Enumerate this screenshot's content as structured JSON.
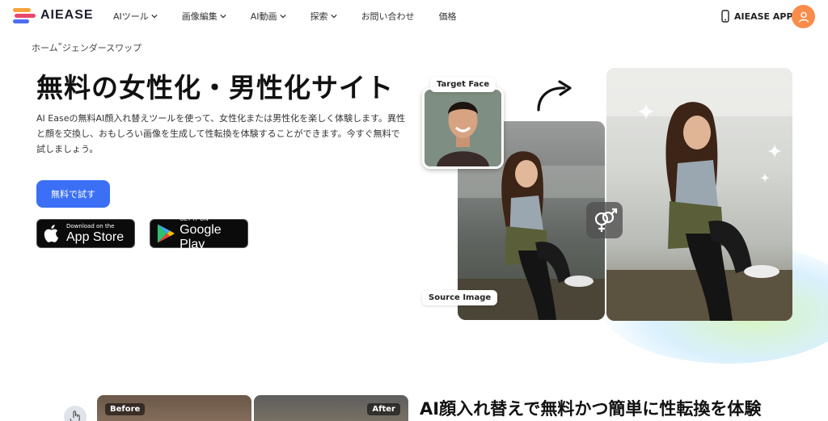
{
  "nav": {
    "logo_text": "AIEASE",
    "items": [
      {
        "label": "AIツール",
        "has_dropdown": true
      },
      {
        "label": "画像編集",
        "has_dropdown": true
      },
      {
        "label": "AI動画",
        "has_dropdown": true
      },
      {
        "label": "探索",
        "has_dropdown": true
      },
      {
        "label": "お問い合わせ",
        "has_dropdown": false
      },
      {
        "label": "価格",
        "has_dropdown": false
      }
    ],
    "app_label": "AIEASE APP",
    "avatar_icon": "user-icon"
  },
  "hero": {
    "breadcrumb": {
      "home": "ホーム",
      "separator": "\"",
      "current": "ジェンダースワップ"
    },
    "title": "無料の女性化・男性化サイト",
    "description": "AI Easeの無料AI顔入れ替えツールを使って、女性化または男性化を楽しく体験します。異性と顔を交換し、おもしろい画像を生成して性転換を体験することができます。今すぐ無料で試しましょう。",
    "cta_label": "無料で試す",
    "app_store": {
      "small": "Download on the",
      "big": "App Store"
    },
    "google_play": {
      "small": "GET IT ON",
      "big": "Google Play"
    }
  },
  "showcase": {
    "target_label": "Target Face",
    "source_label": "Source Image",
    "swap_icon": "gender-swap-icon",
    "arrow_icon": "curved-arrow-icon",
    "sparkle_icon": "sparkle-icon"
  },
  "section2": {
    "title": "AI顔入れ替えで無料かつ簡単に性転換を体験",
    "before_label": "Before",
    "after_label": "After"
  },
  "colors": {
    "accent": "#3b6ff5",
    "avatar": "#f98c4a",
    "text": "#111111"
  }
}
